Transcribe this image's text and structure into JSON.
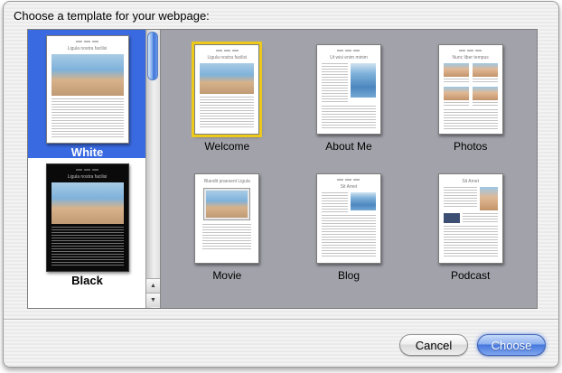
{
  "window": {
    "title": "Choose a template for your webpage:"
  },
  "sidebar": {
    "items": [
      {
        "label": "White",
        "preview_title": "Ligula nostra facilisi",
        "selected": true
      },
      {
        "label": "Black",
        "preview_title": "Ligula nostra facilisi",
        "selected": false
      }
    ]
  },
  "templates": {
    "items": [
      {
        "label": "Welcome",
        "preview_title": "Ligula nostra facilisi",
        "selected": true
      },
      {
        "label": "About Me",
        "preview_title": "Ut wisi enim minim",
        "selected": false
      },
      {
        "label": "Photos",
        "preview_title": "Nunc liber tempus",
        "selected": false
      },
      {
        "label": "Movie",
        "preview_title": "Blandit praesent Ligula",
        "selected": false
      },
      {
        "label": "Blog",
        "preview_title": "Sit Amet",
        "selected": false
      },
      {
        "label": "Podcast",
        "preview_title": "Sit Amet",
        "selected": false
      }
    ]
  },
  "scrollbar": {
    "up_icon": "▲",
    "down_icon": "▼"
  },
  "footer": {
    "cancel_label": "Cancel",
    "choose_label": "Choose"
  },
  "colors": {
    "selection_blue": "#3a6ae1",
    "selection_yellow": "#ecc91a",
    "choose_button_blue": "#4577dd",
    "panel_gray": "#a2a2aa"
  }
}
